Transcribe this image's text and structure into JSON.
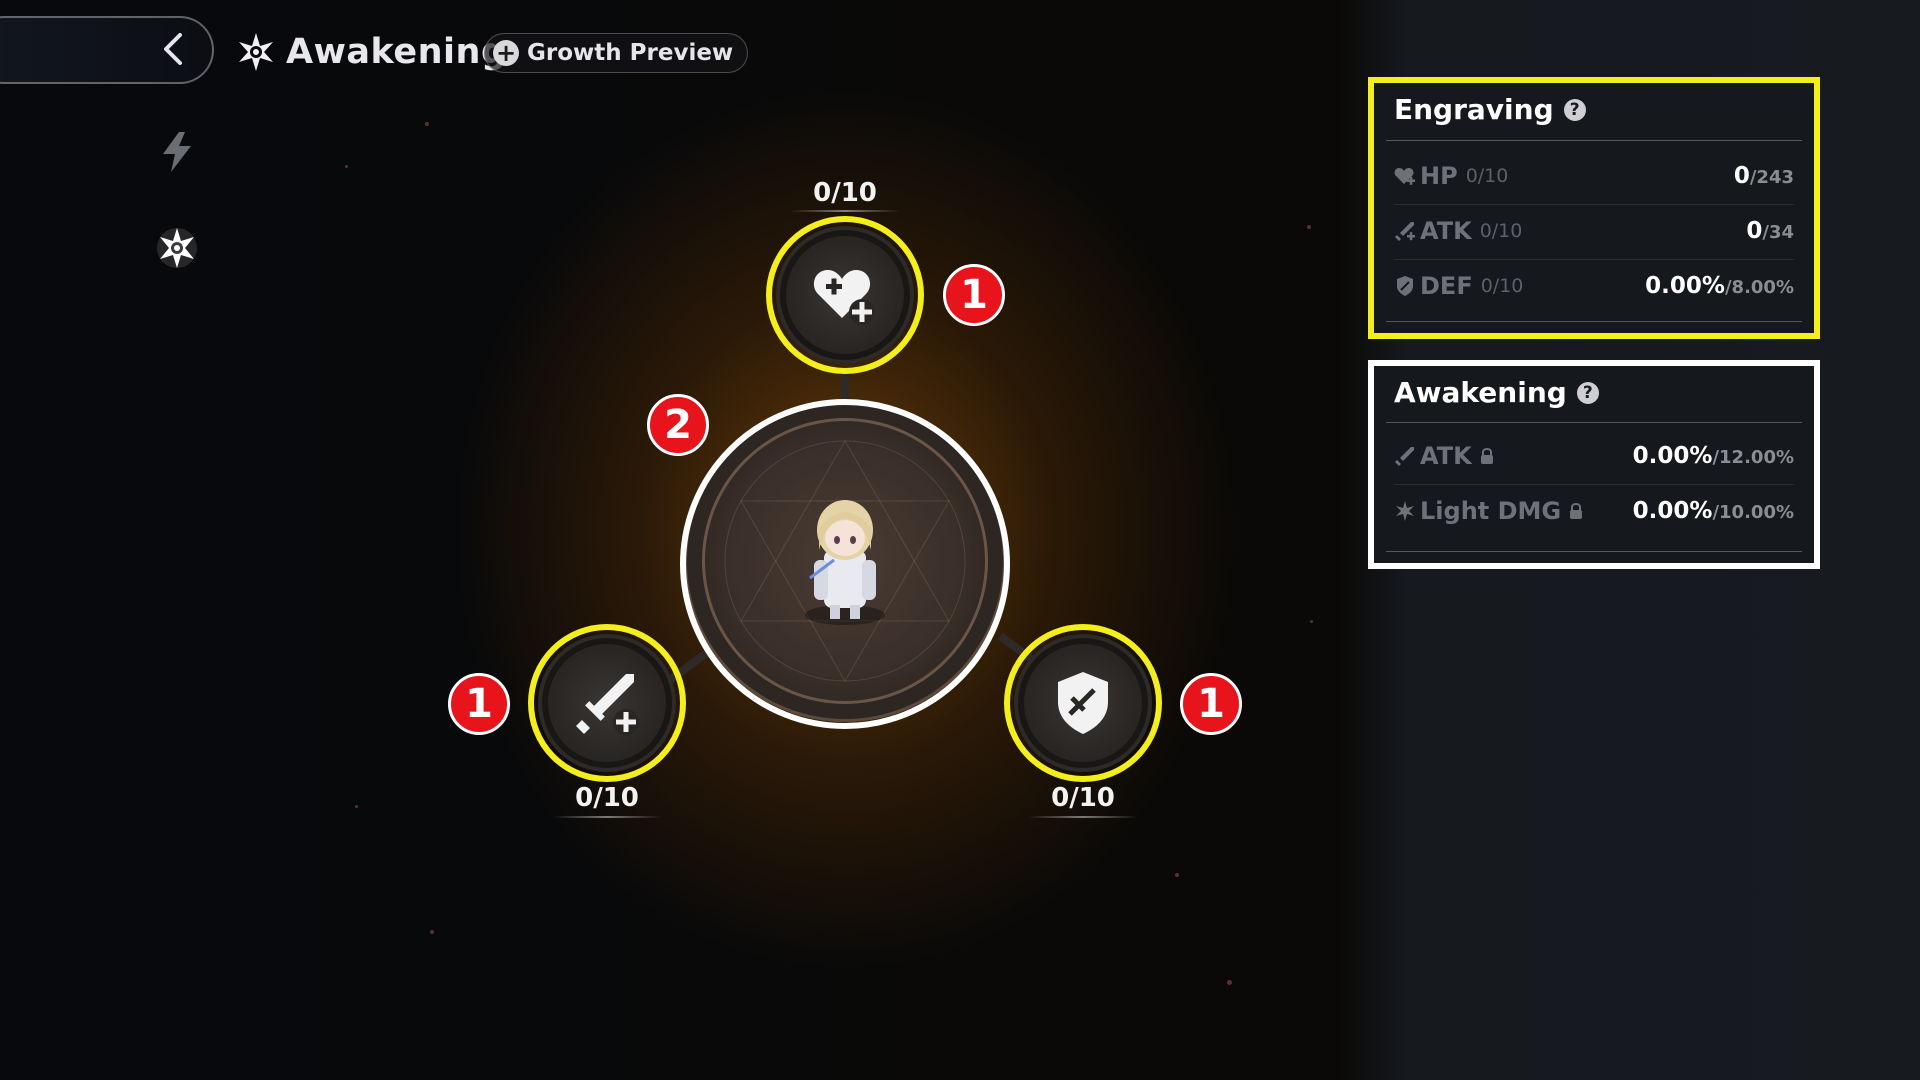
{
  "header": {
    "title": "Awakening",
    "growth_preview_label": "Growth Preview"
  },
  "nodes": {
    "hp_count": "0/10",
    "atk_count": "0/10",
    "def_count": "0/10"
  },
  "badges": {
    "hp": "1",
    "atk": "1",
    "def": "1",
    "center": "2"
  },
  "engraving": {
    "title": "Engraving",
    "rows": [
      {
        "name": "HP",
        "level": "0/10",
        "value": "0",
        "max": "/243",
        "icon": "heart-plus-icon"
      },
      {
        "name": "ATK",
        "level": "0/10",
        "value": "0",
        "max": "/34",
        "icon": "sword-plus-icon"
      },
      {
        "name": "DEF",
        "level": "0/10",
        "value": "0.00%",
        "max": "/8.00%",
        "icon": "shield-icon"
      }
    ]
  },
  "awakening_panel": {
    "title": "Awakening",
    "rows": [
      {
        "name": "ATK",
        "value": "0.00%",
        "max": "/12.00%",
        "icon": "sword-icon",
        "locked": true
      },
      {
        "name": "Light DMG",
        "value": "0.00%",
        "max": "/10.00%",
        "icon": "light-star-icon",
        "locked": true
      }
    ]
  },
  "colors": {
    "highlight_yellow": "#f4ef1a",
    "badge_red": "#e8141b"
  }
}
